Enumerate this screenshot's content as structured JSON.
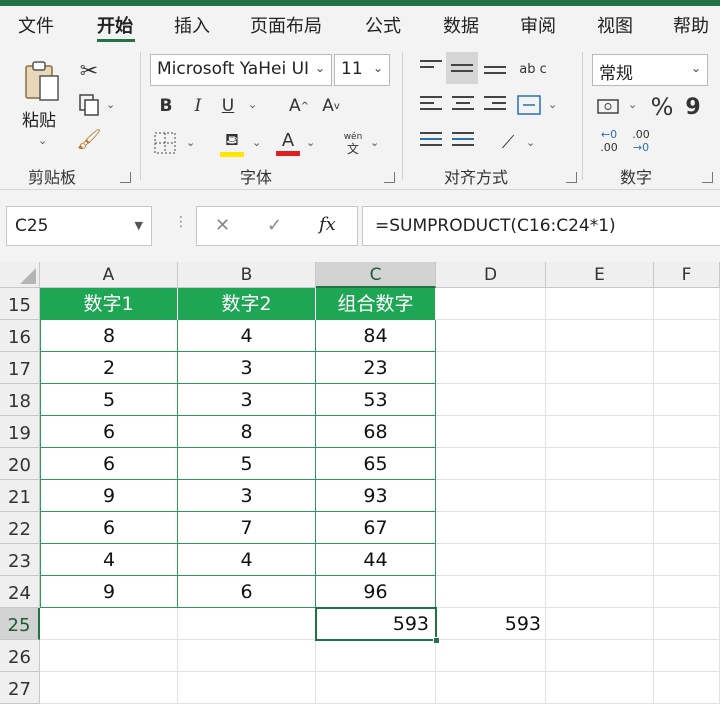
{
  "tabs": [
    "文件",
    "开始",
    "插入",
    "页面布局",
    "公式",
    "数据",
    "审阅",
    "视图",
    "帮助"
  ],
  "ribbon": {
    "clipboard": {
      "paste_label": "粘贴",
      "group_label": "剪贴板"
    },
    "font": {
      "font_name": "Microsoft YaHei UI",
      "font_size": "11",
      "bold": "B",
      "italic": "I",
      "underline": "U",
      "grow": "A",
      "shrink": "A",
      "phonetic_top": "wén",
      "phonetic_bottom": "文",
      "font_color_letter": "A",
      "group_label": "字体",
      "highlight_color": "#ffe600",
      "font_color": "#e02020"
    },
    "alignment": {
      "group_label": "对齐方式",
      "wrap_icon": "ab c"
    },
    "number": {
      "format": "常规",
      "percent": "%",
      "comma": "9",
      "inc_decimal_top": "←0",
      "inc_decimal_bottom": ".00",
      "dec_decimal_top": ".00",
      "dec_decimal_bottom": "→0",
      "group_label": "数字"
    }
  },
  "formula_bar": {
    "name_box": "C25",
    "cancel": "✕",
    "enter": "✓",
    "fx": "fx",
    "formula": "=SUMPRODUCT(C16:C24*1)"
  },
  "grid": {
    "columns": [
      "A",
      "B",
      "C",
      "D",
      "E",
      "F"
    ],
    "rows": [
      "15",
      "16",
      "17",
      "18",
      "19",
      "20",
      "21",
      "22",
      "23",
      "24",
      "25",
      "26",
      "27"
    ],
    "headers": [
      "数字1",
      "数字2",
      "组合数字"
    ],
    "data": [
      [
        "8",
        "4",
        "84"
      ],
      [
        "2",
        "3",
        "23"
      ],
      [
        "5",
        "3",
        "53"
      ],
      [
        "6",
        "8",
        "68"
      ],
      [
        "6",
        "5",
        "65"
      ],
      [
        "9",
        "3",
        "93"
      ],
      [
        "6",
        "7",
        "67"
      ],
      [
        "4",
        "4",
        "44"
      ],
      [
        "9",
        "6",
        "96"
      ]
    ],
    "c25": "593",
    "d25": "593"
  },
  "colors": {
    "accent": "#217346",
    "header_fill": "#1ea654"
  }
}
